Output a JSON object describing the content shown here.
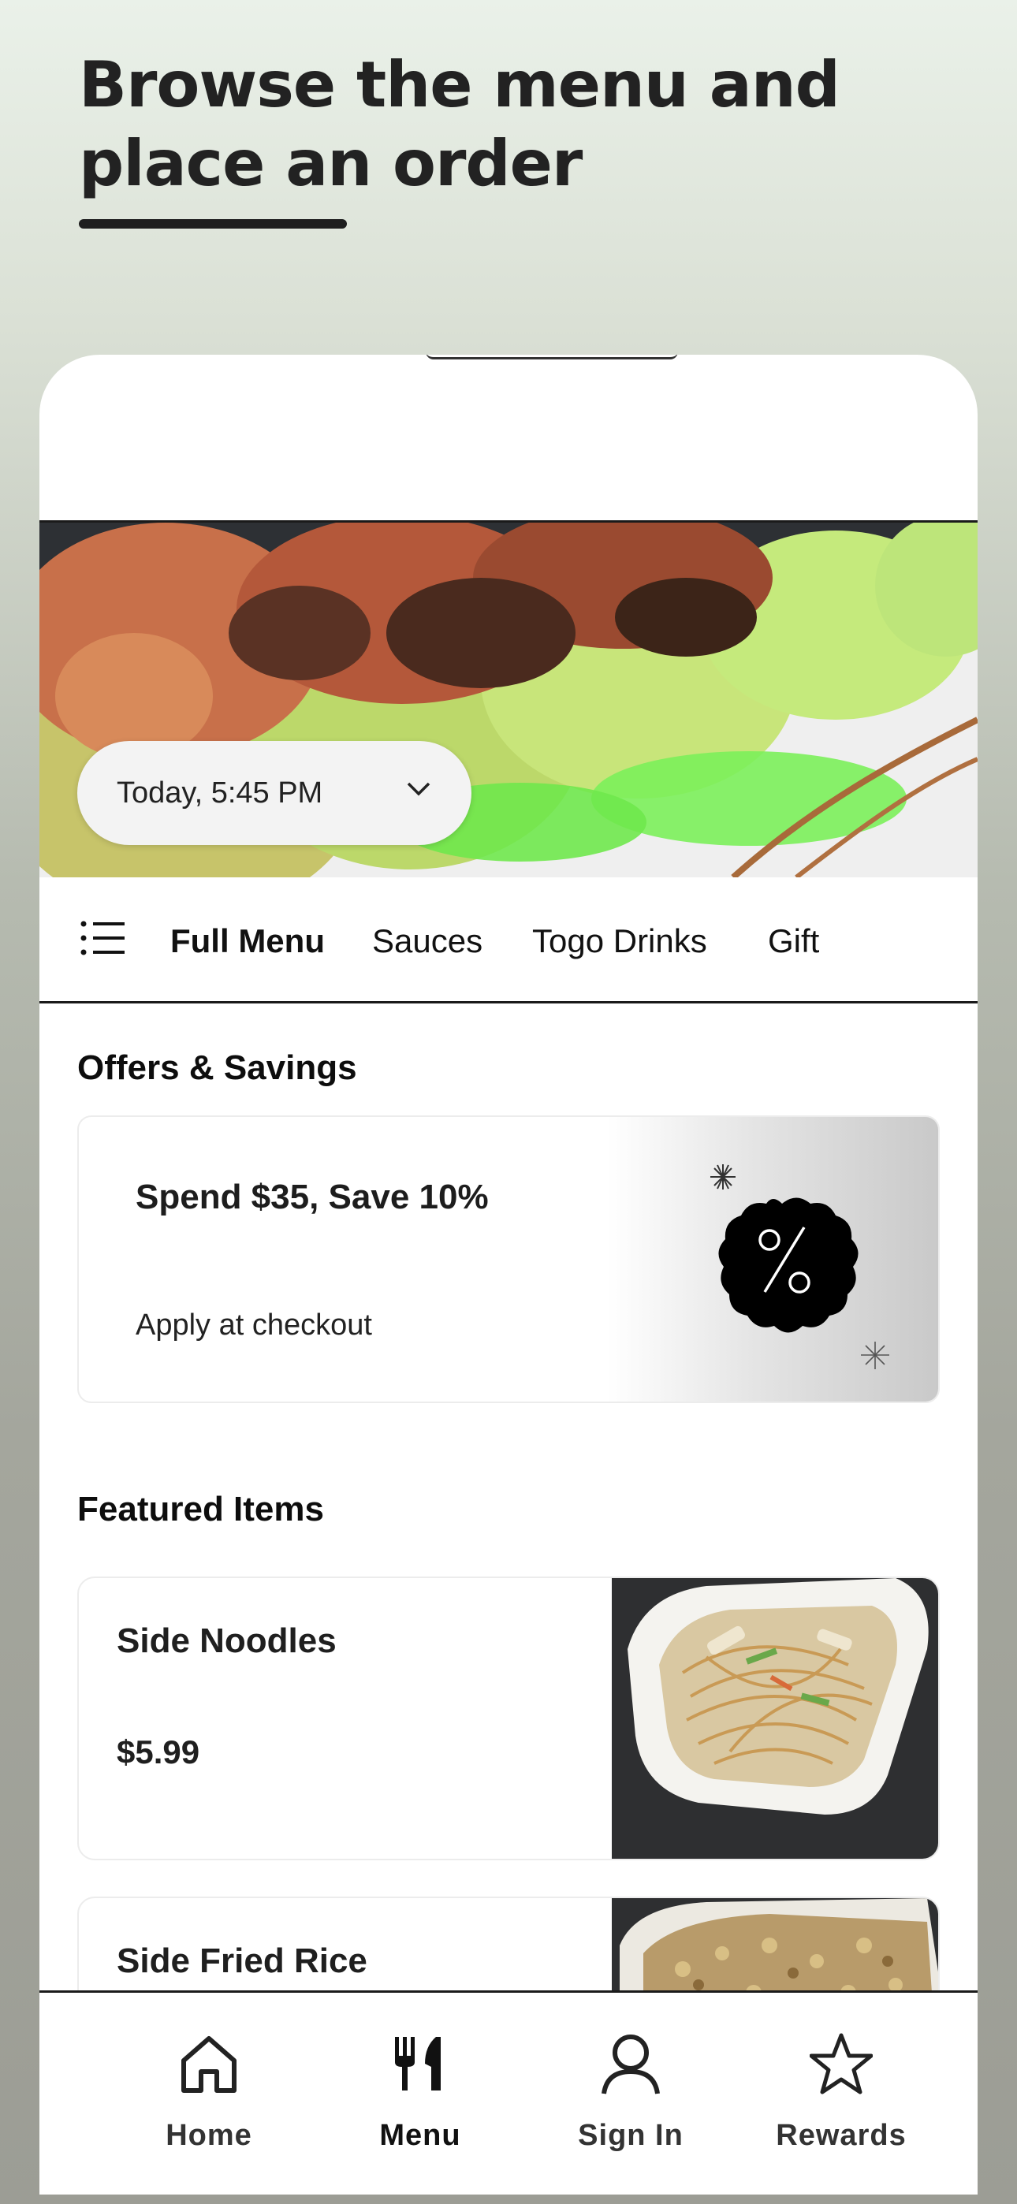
{
  "headline": "Browse the menu and place an order",
  "hero": {
    "time_label": "Today, 5:45 PM",
    "chevron_icon": "chevron-down-icon"
  },
  "categories": {
    "menu_icon": "list-icon",
    "items": [
      "Full Menu",
      "Sauces",
      "Togo Drinks",
      "Gift"
    ],
    "active": "Full Menu"
  },
  "offers": {
    "section_title": "Offers & Savings",
    "card": {
      "title": "Spend $35, Save 10%",
      "subtitle": "Apply at checkout",
      "badge_icon": "percent-badge-icon"
    }
  },
  "featured": {
    "section_title": "Featured Items",
    "items": [
      {
        "name": "Side Noodles",
        "price": "$5.99"
      },
      {
        "name": "Side Fried Rice",
        "price": ""
      }
    ]
  },
  "bottom_nav": {
    "items": [
      {
        "label": "Home",
        "icon": "home-icon"
      },
      {
        "label": "Menu",
        "icon": "fork-knife-icon"
      },
      {
        "label": "Sign In",
        "icon": "user-icon"
      },
      {
        "label": "Rewards",
        "icon": "star-icon"
      }
    ],
    "active": "Menu"
  },
  "colors": {
    "accent": "#111111",
    "background_top": "#eaf1e9",
    "background_bottom": "#9c9d95"
  }
}
